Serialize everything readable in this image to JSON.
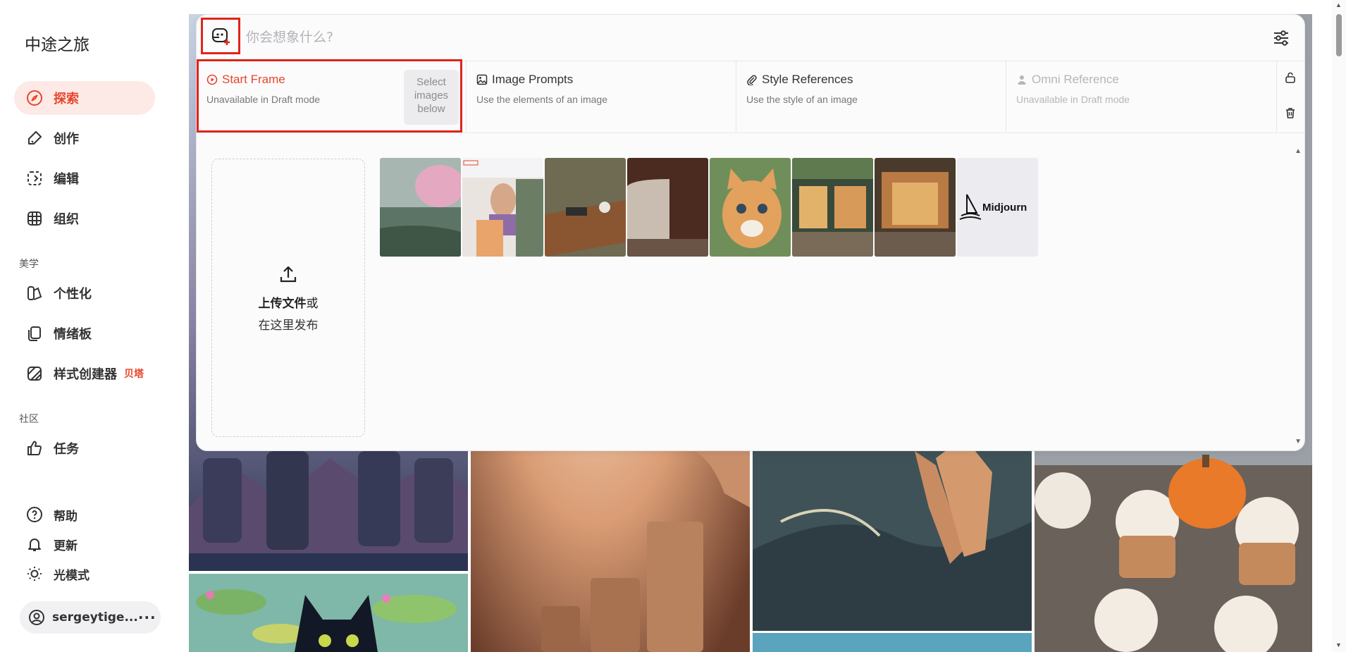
{
  "app": {
    "logo": "中途之旅"
  },
  "sidebar": {
    "items": [
      {
        "label": "探索"
      },
      {
        "label": "创作"
      },
      {
        "label": "编辑"
      },
      {
        "label": "组织"
      }
    ],
    "section_aesthetics": "美学",
    "aesthetics_items": [
      {
        "label": "个性化"
      },
      {
        "label": "情绪板"
      },
      {
        "label": "样式创建器",
        "badge": "贝塔"
      }
    ],
    "section_community": "社区",
    "community_items": [
      {
        "label": "任务"
      }
    ],
    "bottom_items": [
      {
        "label": "帮助"
      },
      {
        "label": "更新"
      },
      {
        "label": "光模式"
      }
    ],
    "user": {
      "name": "sergeytige..."
    }
  },
  "prompt": {
    "placeholder": "你会想象什么?"
  },
  "refs": {
    "start_frame": {
      "title": "Start Frame",
      "sub": "Unavailable in Draft mode",
      "select": "Select images below"
    },
    "image_prompts": {
      "title": "Image Prompts",
      "sub": "Use the elements of an image"
    },
    "style_refs": {
      "title": "Style References",
      "sub": "Use the style of an image"
    },
    "omni_ref": {
      "title": "Omni Reference",
      "sub": "Unavailable in Draft mode"
    }
  },
  "upload": {
    "bold": "上传文件",
    "or": "或",
    "line2": "在这里发布"
  },
  "thumbs": [
    {
      "name": "cherry-blossom-pond-thumb"
    },
    {
      "name": "woman-portrait-collage-thumb"
    },
    {
      "name": "wooden-table-thumb"
    },
    {
      "name": "ceramic-cup-thumb"
    },
    {
      "name": "kitten-thumb"
    },
    {
      "name": "storefront-thumb"
    },
    {
      "name": "cafe-interior-thumb"
    },
    {
      "name": "midjourney-logo-thumb",
      "label": "Midjourn"
    }
  ],
  "colors": {
    "accent": "#e8452c",
    "highlight": "#e0241b"
  }
}
